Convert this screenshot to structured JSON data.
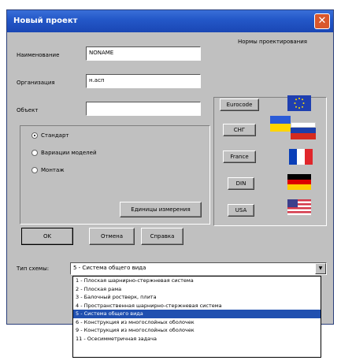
{
  "window": {
    "title": "Новый проект",
    "close_glyph": "✕"
  },
  "form": {
    "name_label": "Наименование",
    "name_value": "NONAME",
    "org_label": "Организация",
    "org_value": "н.асп",
    "object_label": "Объект",
    "object_value": ""
  },
  "radios": [
    {
      "label": "Стандарт",
      "checked": true
    },
    {
      "label": "Вариации моделей",
      "checked": false
    },
    {
      "label": "Монтаж",
      "checked": false
    }
  ],
  "units_button": "Единицы измерения",
  "buttons": {
    "ok": "OK",
    "cancel": "Отмена",
    "help": "Справка"
  },
  "norms": {
    "title": "Нормы проектирования",
    "items": [
      {
        "label": "Eurocode",
        "icon": "eu-flag-icon"
      },
      {
        "label": "СНГ",
        "icon": "cis-flags-icon"
      },
      {
        "label": "France",
        "icon": "france-flag-icon"
      },
      {
        "label": "DIN",
        "icon": "germany-flag-icon"
      },
      {
        "label": "USA",
        "icon": "usa-flag-icon"
      }
    ]
  },
  "scheme": {
    "label": "Тип схемы:",
    "value": "5 - Система общего вида",
    "arrow_glyph": "▼",
    "options": [
      "1 - Плоская шарнирно-стержневая система",
      "2 - Плоская рама",
      "3 - Балочный ростверк, плита",
      "4 - Пространственная шарнирно-стержневая система",
      "5 - Система общего вида",
      "6 - Конструкция из многослойных оболочек",
      "9 - Конструкция из многослойных оболочек",
      "11 - Осесимметричная задача"
    ],
    "selected_index": 4
  },
  "colors": {
    "titlebar": "#2458c9",
    "dialog_bg": "#c0c0c0",
    "selection": "#2050b0",
    "close": "#d9572c"
  }
}
